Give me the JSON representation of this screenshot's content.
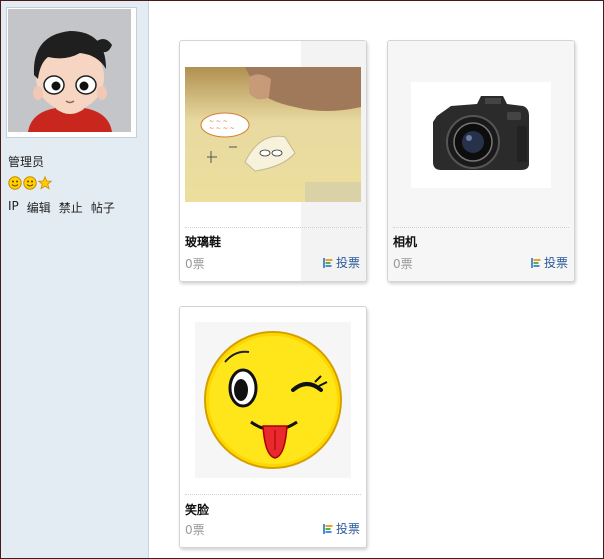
{
  "sidebar": {
    "username": "管理员",
    "rank_icons": [
      "smile-icon",
      "smile-icon",
      "star-icon"
    ],
    "admin_links": [
      "IP",
      "编辑",
      "禁止",
      "帖子"
    ]
  },
  "entries": [
    {
      "title": "玻璃鞋",
      "votes": "0票",
      "vote_label": "投票",
      "image": "glass-shoe-cartoon"
    },
    {
      "title": "相机",
      "votes": "0票",
      "vote_label": "投票",
      "image": "camera-photo"
    },
    {
      "title": "笑脸",
      "votes": "0票",
      "vote_label": "投票",
      "image": "winking-smiley"
    }
  ],
  "colors": {
    "sidebar_bg": "#e3ebf3",
    "link": "#2a5a9a",
    "vote_count": "#999999"
  }
}
